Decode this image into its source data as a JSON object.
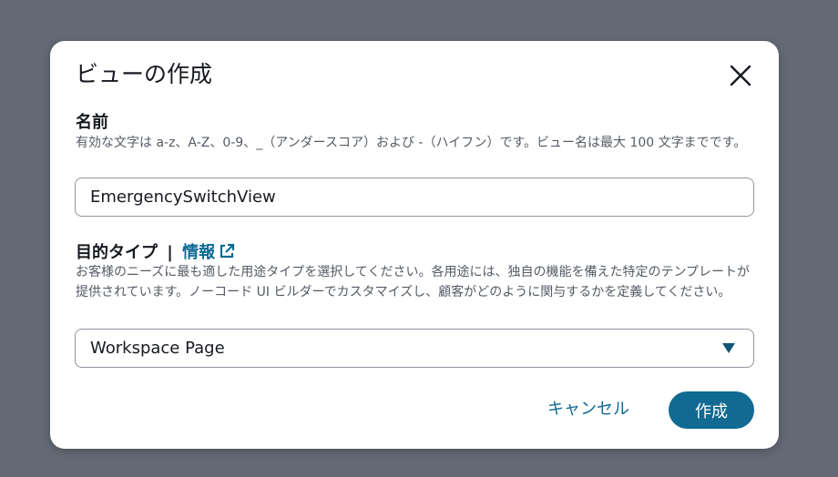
{
  "dialog": {
    "title": "ビューの作成",
    "close_label": "閉じる"
  },
  "name_field": {
    "label": "名前",
    "description": "有効な文字は a-z、A-Z、0-9、_（アンダースコア）および -（ハイフン）です。ビュー名は最大 100 文字までです。",
    "value": "EmergencySwitchView"
  },
  "purpose_field": {
    "label": "目的タイプ",
    "separator": "|",
    "info_link": "情報",
    "description": "お客様のニーズに最も適した用途タイプを選択してください。各用途には、独自の機能を備えた特定のテンプレートが提供されています。ノーコード UI ビルダーでカスタマイズし、顧客がどのように関与するかを定義してください。",
    "selected": "Workspace Page"
  },
  "footer": {
    "cancel_label": "キャンセル",
    "create_label": "作成"
  },
  "colors": {
    "backdrop": "#646a75",
    "accent": "#116a91",
    "text": "#16191f",
    "muted": "#545b64"
  }
}
